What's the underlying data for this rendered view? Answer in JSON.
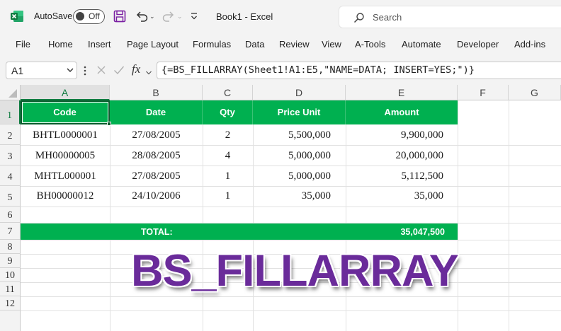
{
  "titlebar": {
    "autosave_label": "AutoSave",
    "toggle_state": "Off",
    "doc_title": "Book1 - Excel",
    "search_placeholder": "Search"
  },
  "menu": [
    "File",
    "Home",
    "Insert",
    "Page Layout",
    "Formulas",
    "Data",
    "Review",
    "View",
    "A-Tools",
    "Automate",
    "Developer",
    "Add-ins"
  ],
  "formula_bar": {
    "name_box": "A1",
    "fx_label": "fx",
    "formula": "{=BS_FILLARRAY(Sheet1!A1:E5,\"NAME=DATA; INSERT=YES;\")}"
  },
  "columns": [
    "A",
    "B",
    "C",
    "D",
    "E",
    "F",
    "G"
  ],
  "rows": [
    "1",
    "2",
    "3",
    "4",
    "5",
    "6",
    "7",
    "8",
    "9",
    "10",
    "11",
    "12"
  ],
  "table": {
    "headers": [
      "Code",
      "Date",
      "Qty",
      "Price Unit",
      "Amount"
    ],
    "rows": [
      [
        "BHTL0000001",
        "27/08/2005",
        "2",
        "5,500,000",
        "9,900,000"
      ],
      [
        "MH00000005",
        "28/08/2005",
        "4",
        "5,000,000",
        "20,000,000"
      ],
      [
        "MHTL000001",
        "27/08/2005",
        "1",
        "5,000,000",
        "5,112,500"
      ],
      [
        "BH00000012",
        "24/10/2006",
        "1",
        "35,000",
        "35,000"
      ]
    ],
    "total_label": "TOTAL:",
    "total_value": "35,047,500"
  },
  "banner": "BS_FILLARRAY",
  "colors": {
    "header_green": "#00b050",
    "banner_purple": "#6a2b9a",
    "excel_green": "#107c41"
  }
}
